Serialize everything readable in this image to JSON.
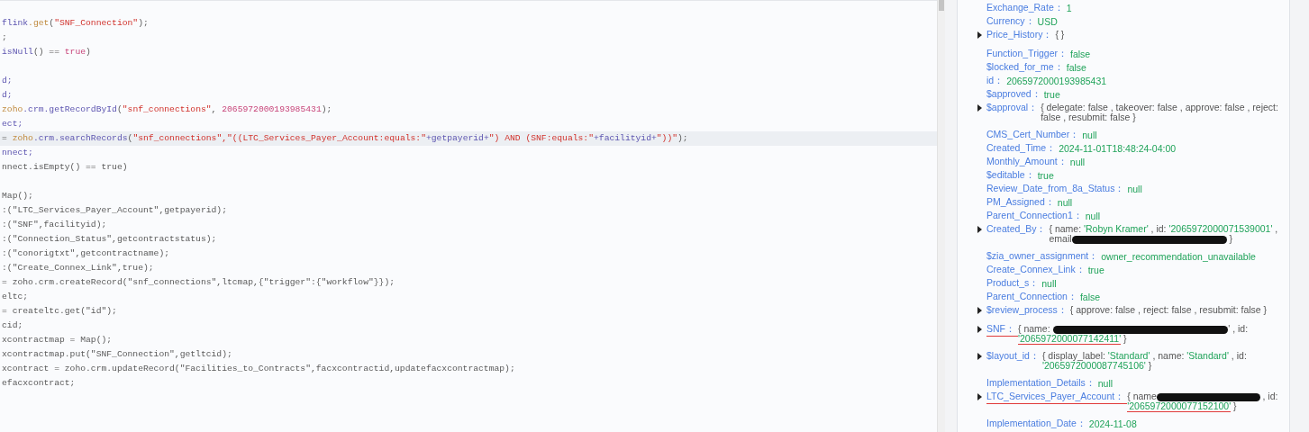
{
  "code_lines": [
    {
      "current": false,
      "tokens": [
        {
          "text": "flink",
          "kind": "m"
        },
        {
          "text": ".get",
          "kind": "f"
        },
        {
          "text": "(",
          "kind": "p"
        },
        {
          "text": "\"SNF_Connection\"",
          "kind": "s"
        },
        {
          "text": ");",
          "kind": "p"
        }
      ]
    },
    {
      "current": false,
      "tokens": [
        {
          "text": ";",
          "kind": "p"
        }
      ]
    },
    {
      "current": false,
      "tokens": [
        {
          "text": "isNull",
          "kind": "m"
        },
        {
          "text": "() == ",
          "kind": "p"
        },
        {
          "text": "true",
          "kind": "k"
        },
        {
          "text": ")",
          "kind": "p"
        }
      ]
    },
    {
      "current": false
    },
    {
      "current": false,
      "tokens": [
        {
          "text": "d;",
          "kind": "m"
        }
      ]
    },
    {
      "current": false,
      "tokens": [
        {
          "text": "d;",
          "kind": "m"
        }
      ]
    },
    {
      "current": false,
      "tokens": [
        {
          "text": "zoho",
          "kind": "f"
        },
        {
          "text": ".crm.getRecordById",
          "kind": "m"
        },
        {
          "text": "(",
          "kind": "p"
        },
        {
          "text": "\"snf_connections\"",
          "kind": "s"
        },
        {
          "text": ", ",
          "kind": "p"
        },
        {
          "text": "2065972000193985431",
          "kind": "k"
        },
        {
          "text": ");",
          "kind": "p"
        }
      ]
    },
    {
      "current": false,
      "tokens": [
        {
          "text": "ect;",
          "kind": "m"
        }
      ]
    },
    {
      "current": true,
      "tokens": [
        {
          "text": "= ",
          "kind": "p"
        },
        {
          "text": "zoho",
          "kind": "f"
        },
        {
          "text": ".crm.searchRecords",
          "kind": "m"
        },
        {
          "text": "(",
          "kind": "p"
        },
        {
          "text": "\"snf_connections\",\"((LTC_Services_Payer_Account:equals:\"",
          "kind": "s"
        },
        {
          "text": "+getpayerid+",
          "kind": "m"
        },
        {
          "text": "\") AND (SNF:equals:\"",
          "kind": "s"
        },
        {
          "text": "+facilityid+",
          "kind": "m"
        },
        {
          "text": "\"))\"",
          "kind": "s"
        },
        {
          "text": ");",
          "kind": "p"
        }
      ]
    },
    {
      "current": false,
      "tokens": [
        {
          "text": "nnect;",
          "kind": "m"
        }
      ]
    },
    {
      "current": false,
      "tokens": [
        {
          "text": "nnect.isEmpty() == true)",
          "kind": "p"
        }
      ]
    },
    {
      "current": false
    },
    {
      "current": false,
      "tokens": [
        {
          "text": "Map();",
          "kind": "p"
        }
      ]
    },
    {
      "current": false,
      "tokens": [
        {
          "text": ":(\"LTC_Services_Payer_Account\",getpayerid);",
          "kind": "p"
        }
      ]
    },
    {
      "current": false,
      "tokens": [
        {
          "text": ":(\"SNF\",facilityid);",
          "kind": "p"
        }
      ]
    },
    {
      "current": false,
      "tokens": [
        {
          "text": ":(\"Connection_Status\",getcontractstatus);",
          "kind": "p"
        }
      ]
    },
    {
      "current": false,
      "tokens": [
        {
          "text": ":(\"conorigtxt\",getcontractname);",
          "kind": "p"
        }
      ]
    },
    {
      "current": false,
      "tokens": [
        {
          "text": ":(\"Create_Connex_Link\",true);",
          "kind": "p"
        }
      ]
    },
    {
      "current": false,
      "tokens": [
        {
          "text": "= zoho.crm.createRecord(\"snf_connections\",ltcmap,{\"trigger\":{\"workflow\"}});",
          "kind": "p"
        }
      ]
    },
    {
      "current": false,
      "tokens": [
        {
          "text": "eltc;",
          "kind": "p"
        }
      ]
    },
    {
      "current": false,
      "tokens": [
        {
          "text": "= createltc.get(\"id\");",
          "kind": "p"
        }
      ]
    },
    {
      "current": false,
      "tokens": [
        {
          "text": "cid;",
          "kind": "p"
        }
      ]
    },
    {
      "current": false,
      "tokens": [
        {
          "text": "xcontractmap = Map();",
          "kind": "p"
        }
      ]
    },
    {
      "current": false,
      "tokens": [
        {
          "text": "xcontractmap.put(\"SNF_Connection\",getltcid);",
          "kind": "p"
        }
      ]
    },
    {
      "current": false,
      "tokens": [
        {
          "text": "xcontract = zoho.crm.updateRecord(\"Facilities_to_Contracts\",facxcontractid,updatefacxcontractmap);",
          "kind": "p"
        }
      ]
    },
    {
      "current": false,
      "tokens": [
        {
          "text": "efacxcontract;",
          "kind": "p"
        }
      ]
    }
  ],
  "record": [
    {
      "key": "Exchange_Rate：",
      "expandable": false,
      "key_underlined": false,
      "value": [
        {
          "text": "1",
          "kind": "val"
        }
      ]
    },
    {
      "key": "Currency：",
      "expandable": false,
      "key_underlined": false,
      "value": [
        {
          "text": "USD",
          "kind": "val"
        }
      ]
    },
    {
      "key": "Price_History：",
      "expandable": true,
      "key_underlined": false,
      "value": [
        {
          "text": "{ }",
          "kind": "punct"
        }
      ]
    },
    {
      "key": "Function_Trigger：",
      "expandable": false,
      "key_underlined": false,
      "value": [
        {
          "text": "false",
          "kind": "val"
        }
      ]
    },
    {
      "key": "$locked_for_me：",
      "expandable": false,
      "key_underlined": false,
      "value": [
        {
          "text": "false",
          "kind": "val"
        }
      ]
    },
    {
      "key": "id：",
      "expandable": false,
      "key_underlined": false,
      "value": [
        {
          "text": "2065972000193985431",
          "kind": "val"
        }
      ]
    },
    {
      "key": "$approved：",
      "expandable": false,
      "key_underlined": false,
      "value": [
        {
          "text": "true",
          "kind": "val"
        }
      ]
    },
    {
      "key": "$approval：",
      "expandable": true,
      "key_underlined": false,
      "value": [
        {
          "text": "{ delegate: false , takeover: false , approve: false , reject: false , resubmit: false }",
          "kind": "punct"
        }
      ]
    },
    {
      "key": "CMS_Cert_Number：",
      "expandable": false,
      "key_underlined": false,
      "value": [
        {
          "text": "null",
          "kind": "val"
        }
      ]
    },
    {
      "key": "Created_Time：",
      "expandable": false,
      "key_underlined": false,
      "value": [
        {
          "text": "2024-11-01T18:48:24-04:00",
          "kind": "val"
        }
      ]
    },
    {
      "key": "Monthly_Amount：",
      "expandable": false,
      "key_underlined": false,
      "value": [
        {
          "text": "null",
          "kind": "val"
        }
      ]
    },
    {
      "key": "$editable：",
      "expandable": false,
      "key_underlined": false,
      "value": [
        {
          "text": "true",
          "kind": "val"
        }
      ]
    },
    {
      "key": "Review_Date_from_8a_Status：",
      "expandable": false,
      "key_underlined": false,
      "value": [
        {
          "text": "null",
          "kind": "val"
        }
      ]
    },
    {
      "key": "PM_Assigned：",
      "expandable": false,
      "key_underlined": false,
      "value": [
        {
          "text": "null",
          "kind": "val"
        }
      ]
    },
    {
      "key": "Parent_Connection1：",
      "expandable": false,
      "key_underlined": false,
      "value": [
        {
          "text": "null",
          "kind": "val"
        }
      ]
    },
    {
      "key": "Created_By：",
      "expandable": true,
      "key_underlined": false,
      "value": [
        {
          "text": "{ name: ",
          "kind": "punct"
        },
        {
          "text": "'Robyn Kramer'",
          "kind": "val"
        },
        {
          "text": " , id: ",
          "kind": "punct"
        },
        {
          "text": "'2065972000071539001'",
          "kind": "val"
        },
        {
          "text": " , email",
          "kind": "punct"
        },
        {
          "kind": "redaction"
        },
        {
          "text": " }",
          "kind": "punct"
        }
      ]
    },
    {
      "key": "$zia_owner_assignment：",
      "expandable": false,
      "key_underlined": false,
      "value": [
        {
          "text": "owner_recommendation_unavailable",
          "kind": "val"
        }
      ]
    },
    {
      "key": "Create_Connex_Link：",
      "expandable": false,
      "key_underlined": false,
      "value": [
        {
          "text": "true",
          "kind": "val"
        }
      ]
    },
    {
      "key": "Product_s：",
      "expandable": false,
      "key_underlined": false,
      "value": [
        {
          "text": "null",
          "kind": "val"
        }
      ]
    },
    {
      "key": "Parent_Connection：",
      "expandable": false,
      "key_underlined": false,
      "value": [
        {
          "text": "false",
          "kind": "val"
        }
      ]
    },
    {
      "key": "$review_process：",
      "expandable": true,
      "key_underlined": false,
      "value": [
        {
          "text": "{ approve: false , reject: false , resubmit: false }",
          "kind": "punct"
        }
      ]
    },
    {
      "key": "SNF：",
      "expandable": true,
      "key_underlined": true,
      "value": [
        {
          "text": "{ name: ",
          "kind": "punct"
        },
        {
          "kind": "redaction"
        },
        {
          "text": "' , id: ",
          "kind": "punct"
        },
        {
          "text": "'2065972000077142411'",
          "kind": "val",
          "underlined": true
        },
        {
          "text": " }",
          "kind": "punct"
        }
      ]
    },
    {
      "key": "$layout_id：",
      "expandable": true,
      "key_underlined": false,
      "value": [
        {
          "text": "{ display_label: ",
          "kind": "punct"
        },
        {
          "text": "'Standard'",
          "kind": "val"
        },
        {
          "text": " , name: ",
          "kind": "punct"
        },
        {
          "text": "'Standard'",
          "kind": "val"
        },
        {
          "text": " , id: ",
          "kind": "punct"
        },
        {
          "text": "'2065972000087745106'",
          "kind": "val"
        },
        {
          "text": " }",
          "kind": "punct"
        }
      ]
    },
    {
      "key": "Implementation_Details：",
      "expandable": false,
      "key_underlined": false,
      "value": [
        {
          "text": "null",
          "kind": "val"
        }
      ]
    },
    {
      "key": "LTC_Services_Payer_Account：",
      "expandable": true,
      "key_underlined": true,
      "value": [
        {
          "text": "{ name",
          "kind": "punct"
        },
        {
          "kind": "redaction"
        },
        {
          "text": " , id: ",
          "kind": "punct"
        },
        {
          "text": "'2065972000077152100'",
          "kind": "val",
          "underlined": true
        },
        {
          "text": " }",
          "kind": "punct"
        }
      ]
    },
    {
      "key": "Implementation_Date：",
      "expandable": false,
      "key_underlined": false,
      "value": [
        {
          "text": "2024-11-08",
          "kind": "val"
        }
      ]
    }
  ]
}
